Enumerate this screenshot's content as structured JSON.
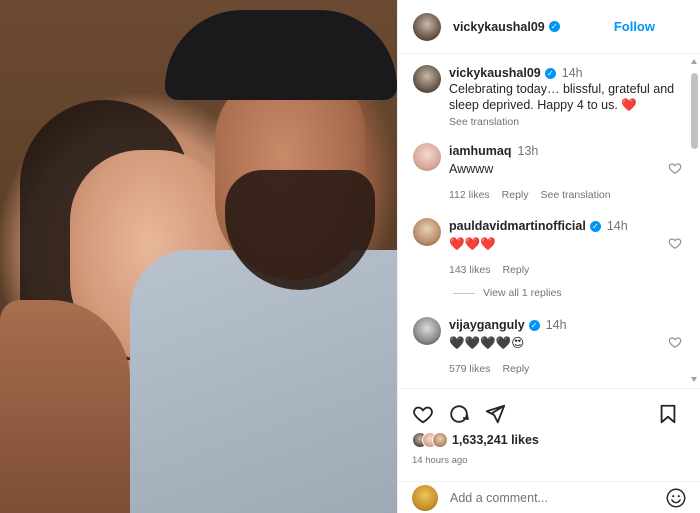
{
  "post": {
    "author": "vickykaushal09",
    "follow_label": "Follow",
    "caption": {
      "username": "vickykaushal09",
      "time": "14h",
      "text": "Celebrating today… blissful, grateful and sleep deprived. Happy 4 to us.",
      "heart": "❤️",
      "see_translation": "See translation"
    }
  },
  "comments": [
    {
      "username": "iamhumaq",
      "verified": false,
      "time": "13h",
      "text": "Awwww",
      "likes": "112 likes",
      "reply": "Reply",
      "see_translation": "See translation"
    },
    {
      "username": "pauldavidmartinofficial",
      "verified": true,
      "time": "14h",
      "text": "❤️❤️❤️",
      "likes": "143 likes",
      "reply": "Reply"
    },
    {
      "username": "vijayganguly",
      "verified": true,
      "time": "14h",
      "text": "🖤🖤🖤🖤😍",
      "likes": "579 likes",
      "reply": "Reply"
    }
  ],
  "view_replies": "View all 1 replies",
  "footer": {
    "likes_count": "1,633,241 likes",
    "posted_ago": "14 hours ago",
    "add_comment_placeholder": "Add a comment..."
  },
  "icons": {
    "verified": "verified-badge-icon",
    "like": "heart-icon",
    "comment": "comment-icon",
    "share": "send-icon",
    "save": "bookmark-icon",
    "emoji": "emoji-icon",
    "comment_like": "heart-outline-icon"
  },
  "colors": {
    "accent": "#0095f6",
    "heart": "#ed4956",
    "text": "#262626",
    "muted": "#737373"
  }
}
